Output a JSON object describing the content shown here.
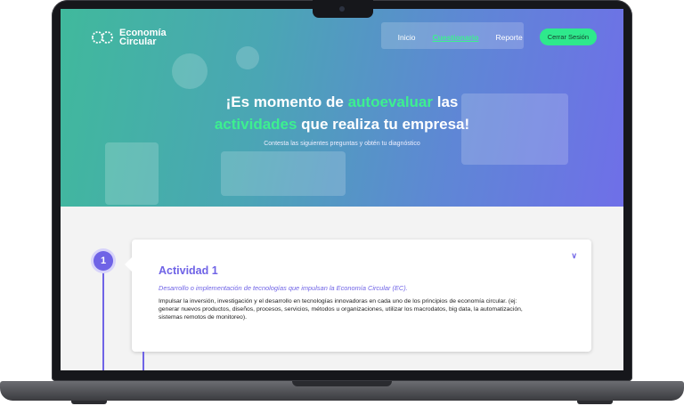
{
  "brand": {
    "line1": "Economía",
    "line2": "Circular"
  },
  "nav": {
    "items": [
      "Inicio",
      "Cuestionario",
      "Reporte"
    ],
    "active": "Cuestionario",
    "logout_label": "Cerrar Sesión"
  },
  "hero": {
    "title_part1": "¡Es momento de ",
    "title_highlight1": "autoevaluar",
    "title_part2": " las",
    "title_highlight2": "actividades",
    "title_part3": " que realiza tu empresa!",
    "subtitle": "Contesta las siguientes preguntas y obtén tu diagnóstico"
  },
  "activity": {
    "step_number": "1",
    "title": "Actividad 1",
    "subtitle": "Desarrollo o implementación de tecnologías que impulsan la Economía Circular (EC).",
    "description": "Impulsar la inversión, investigación y el desarrollo en tecnologías innovadoras en cada uno de los principios de economía circular. (ej: generar nuevos productos, diseños, procesos, servicios, métodos u organizaciones, utilizar los macrodatos, big data, la automatización, sistemas remotos de monitoreo).",
    "toggle_icon": "chevron-down-icon"
  },
  "colors": {
    "accent": "#6f63e6",
    "highlight": "#3cf08f",
    "button": "#2ee98c"
  }
}
